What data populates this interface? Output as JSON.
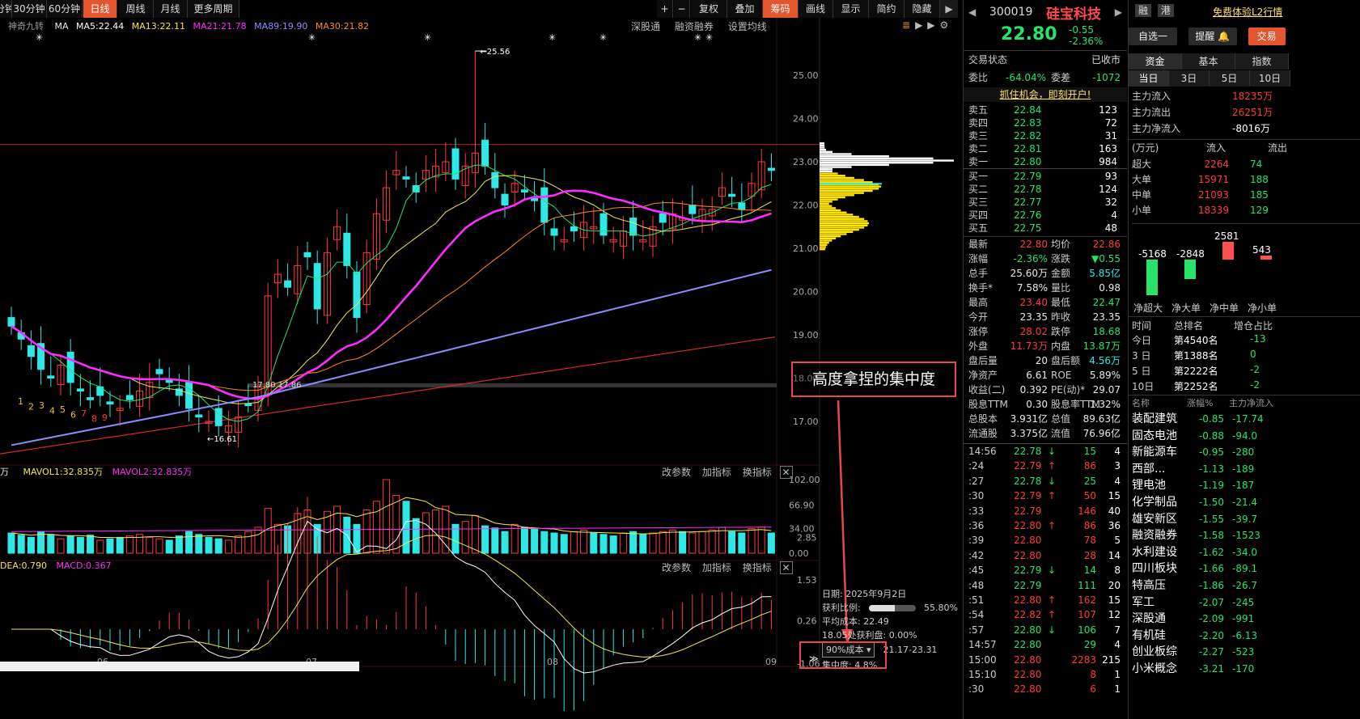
{
  "toolbar": {
    "left": [
      {
        "label": "分钟",
        "active": false
      },
      {
        "label": "30分钟",
        "active": false
      },
      {
        "label": "60分钟",
        "active": false
      },
      {
        "label": "日线",
        "active": true
      },
      {
        "label": "周线",
        "active": false
      },
      {
        "label": "月线",
        "active": false
      },
      {
        "label": "更多周期",
        "active": false
      }
    ],
    "right": [
      {
        "label": "+"
      },
      {
        "label": "−"
      },
      {
        "label": "复权"
      },
      {
        "label": "叠加"
      },
      {
        "label": "筹码"
      },
      {
        "label": "画线"
      },
      {
        "label": "显示"
      },
      {
        "label": "简约"
      },
      {
        "label": "隐藏"
      }
    ],
    "active_right": "筹码"
  },
  "ma_bar": {
    "name": "神奇九转",
    "ma": "MA",
    "ma5": "MA5:22.44",
    "ma13": "MA13:22.11",
    "ma21": "MA21:21.78",
    "ma89": "MA89:19.90",
    "ma30": "MA30:21.82",
    "links": [
      "深股通",
      "融资融券",
      "设置均线"
    ]
  },
  "price_axis": [
    "25.00",
    "24.00",
    "23.00",
    "22.00",
    "21.00",
    "20.00",
    "19.00",
    "18.00",
    "17.00"
  ],
  "high_label": "25.56",
  "low_label": "16.61",
  "cost_label": "17.80 17.86",
  "nine_turn": [
    "1",
    "2",
    "3",
    "4",
    "5",
    "6",
    "7",
    "8",
    "9"
  ],
  "nine_turn_red": [
    "7",
    "8",
    "9"
  ],
  "vol_panel": {
    "title": "万",
    "mavol1": "MAVOL1:32.835万",
    "mavol2": "MAVOL2:32.835万",
    "links": [
      "改参数",
      "加指标",
      "换指标"
    ],
    "axis": [
      "102.00",
      "66.90",
      "34.00",
      "0.00"
    ]
  },
  "macd_panel": {
    "dea": "DEA:0.790",
    "macd": "MACD:0.367",
    "links": [
      "改参数",
      "加指标",
      "换指标"
    ],
    "axis": [
      "2.85",
      "1.53",
      "0.26",
      "-1.06"
    ]
  },
  "date_axis": [
    "06",
    "07",
    "08",
    "09"
  ],
  "chip": {
    "date": "日期: 2025年9月2日",
    "profit_label": "获利比例:",
    "profit_value": "55.80%",
    "avg_cost": "平均成本: 22.49",
    "profit_line": "18.05处获利盘: 0.00%",
    "select": "90%成本",
    "range": "21.17-23.31",
    "concentration": "集中度: 4.8%"
  },
  "annotation": "高度拿捏的集中度",
  "stock": {
    "code": "300019",
    "name": "硅宝科技",
    "price": "22.80",
    "change": "-0.55",
    "pct": "-2.36%",
    "tags": [
      "融",
      "港"
    ],
    "promo": "免费体验L2行情",
    "btn_self": "自选一",
    "btn_alert": "提醒",
    "btn_trade": "交易"
  },
  "status": {
    "label": "交易状态",
    "value": "已收市"
  },
  "weibi": {
    "l1": "委比",
    "v1": "-64.04%",
    "l2": "委差",
    "v2": "-1072"
  },
  "banner": "抓住机会，即刻开户!",
  "asks": [
    [
      "卖五",
      "22.84",
      "123"
    ],
    [
      "卖四",
      "22.83",
      "72"
    ],
    [
      "卖三",
      "22.82",
      "31"
    ],
    [
      "卖二",
      "22.81",
      "163"
    ],
    [
      "卖一",
      "22.80",
      "984"
    ]
  ],
  "bids": [
    [
      "买一",
      "22.79",
      "93"
    ],
    [
      "买二",
      "22.78",
      "124"
    ],
    [
      "买三",
      "22.77",
      "32"
    ],
    [
      "买四",
      "22.76",
      "4"
    ],
    [
      "买五",
      "22.75",
      "48"
    ]
  ],
  "quote_rows": [
    [
      "最新",
      "22.80",
      "均价",
      "22.86",
      "red",
      "red"
    ],
    [
      "涨幅",
      "-2.36%",
      "涨跌",
      "▼0.55",
      "grn",
      "grn"
    ],
    [
      "总手",
      "25.60万",
      "金额",
      "5.85亿",
      "wht",
      "cyan"
    ],
    [
      "换手*",
      "7.58%",
      "量比",
      "0.98",
      "wht",
      "wht"
    ],
    [
      "最高",
      "23.40",
      "最低",
      "22.47",
      "red",
      "grn"
    ],
    [
      "今开",
      "23.35",
      "昨收",
      "23.35",
      "wht",
      "wht"
    ],
    [
      "涨停",
      "28.02",
      "跌停",
      "18.68",
      "red",
      "grn"
    ],
    [
      "外盘",
      "11.73万",
      "内盘",
      "13.87万",
      "red",
      "grn"
    ],
    [
      "盘后量",
      "20",
      "盘后额",
      "4.56万",
      "wht",
      "cyan"
    ],
    [
      "净资产",
      "6.61",
      "ROE",
      "5.89%",
      "wht",
      "wht"
    ],
    [
      "收益(二)",
      "0.392",
      "PE(动)*",
      "29.07",
      "wht",
      "wht"
    ],
    [
      "股息TTM",
      "0.30",
      "股息率TTM",
      "1.32%",
      "wht",
      "wht"
    ],
    [
      "总股本",
      "3.931亿",
      "总值",
      "89.63亿",
      "wht",
      "wht"
    ],
    [
      "流通股",
      "3.375亿",
      "流值",
      "76.96亿",
      "wht",
      "wht"
    ]
  ],
  "ticks": [
    [
      "14:56",
      "22.78",
      "down",
      "15",
      "4",
      "grn"
    ],
    [
      ":24",
      "22.79",
      "up",
      "86",
      "3",
      "red"
    ],
    [
      ":27",
      "22.78",
      "down",
      "25",
      "4",
      "grn"
    ],
    [
      ":30",
      "22.79",
      "up",
      "50",
      "15",
      "red"
    ],
    [
      ":33",
      "22.79",
      "",
      "146",
      "40",
      "red"
    ],
    [
      ":36",
      "22.80",
      "up",
      "86",
      "36",
      "red"
    ],
    [
      ":39",
      "22.80",
      "",
      "78",
      "5",
      "red"
    ],
    [
      ":42",
      "22.80",
      "",
      "28",
      "14",
      "red"
    ],
    [
      ":45",
      "22.79",
      "down",
      "14",
      "8",
      "grn"
    ],
    [
      ":48",
      "22.79",
      "",
      "111",
      "20",
      "grn"
    ],
    [
      ":51",
      "22.80",
      "up",
      "162",
      "15",
      "red"
    ],
    [
      ":54",
      "22.82",
      "up",
      "107",
      "12",
      "red"
    ],
    [
      ":57",
      "22.80",
      "down",
      "106",
      "7",
      "grn"
    ],
    [
      "14:57",
      "22.80",
      "",
      "29",
      "4",
      "grn"
    ],
    [
      "15:00",
      "22.80",
      "",
      "2283",
      "215",
      "red"
    ],
    [
      "15:10",
      "22.80",
      "",
      "8",
      "1",
      "red"
    ],
    [
      ":30",
      "22.80",
      "",
      "6",
      "1",
      "red"
    ]
  ],
  "far": {
    "tabs": [
      "资金",
      "基本",
      "指数"
    ],
    "subtabs": [
      "当日",
      "3日",
      "5日",
      "10日"
    ],
    "flows": [
      [
        "主力流入",
        "18235万"
      ],
      [
        "主力流出",
        "26251万"
      ],
      [
        "主力净流入",
        "-8016万"
      ]
    ],
    "unit": "(万元)",
    "cols": [
      "流入",
      "流出"
    ],
    "orders": [
      [
        "超大",
        "2264",
        "74"
      ],
      [
        "大单",
        "15971",
        "188"
      ],
      [
        "中单",
        "21093",
        "185"
      ],
      [
        "小单",
        "18339",
        "129"
      ]
    ],
    "bar_values": [
      "-5168",
      "-2848",
      "2581",
      "543"
    ],
    "bar_labels": [
      "净超大",
      "净大单",
      "净中单",
      "净小单"
    ],
    "rank_head": [
      "时间",
      "总排名",
      "增仓占比"
    ],
    "ranks": [
      [
        "今日",
        "第4540名",
        "-13"
      ],
      [
        "3 日",
        "第1388名",
        "0"
      ],
      [
        "5 日",
        "第2222名",
        "-2"
      ],
      [
        "10日",
        "第2252名",
        "-2"
      ]
    ],
    "sector_head": [
      "名称",
      "涨幅%",
      "主力净流入"
    ],
    "sectors": [
      [
        "装配建筑",
        "-0.85",
        "-17.74"
      ],
      [
        "固态电池",
        "-0.88",
        "-94.0"
      ],
      [
        "新能源车",
        "-0.95",
        "-280"
      ],
      [
        "西部...",
        "-1.13",
        "-189"
      ],
      [
        "锂电池",
        "-1.19",
        "-187"
      ],
      [
        "化学制品",
        "-1.50",
        "-21.4"
      ],
      [
        "雄安新区",
        "-1.55",
        "-39.7"
      ],
      [
        "融资融券",
        "-1.58",
        "-1523"
      ],
      [
        "水利建设",
        "-1.62",
        "-34.0"
      ],
      [
        "四川板块",
        "-1.66",
        "-89.1"
      ],
      [
        "特高压",
        "-1.86",
        "-26.7"
      ],
      [
        "军工",
        "-2.07",
        "-245"
      ],
      [
        "深股通",
        "-2.09",
        "-991"
      ],
      [
        "有机硅",
        "-2.20",
        "-6.13"
      ],
      [
        "创业板综",
        "-2.27",
        "-523"
      ],
      [
        "小米概念",
        "-3.21",
        "-170"
      ]
    ]
  },
  "colors": {
    "up": "#ff3b3b",
    "down": "#2ee8e8",
    "ma5": "#ffffff",
    "ma13": "#f2e94a",
    "ma21": "#ff2bff",
    "ma89": "#8c8cff",
    "ma30": "#ff8a1f",
    "accent": "#e4572e"
  }
}
